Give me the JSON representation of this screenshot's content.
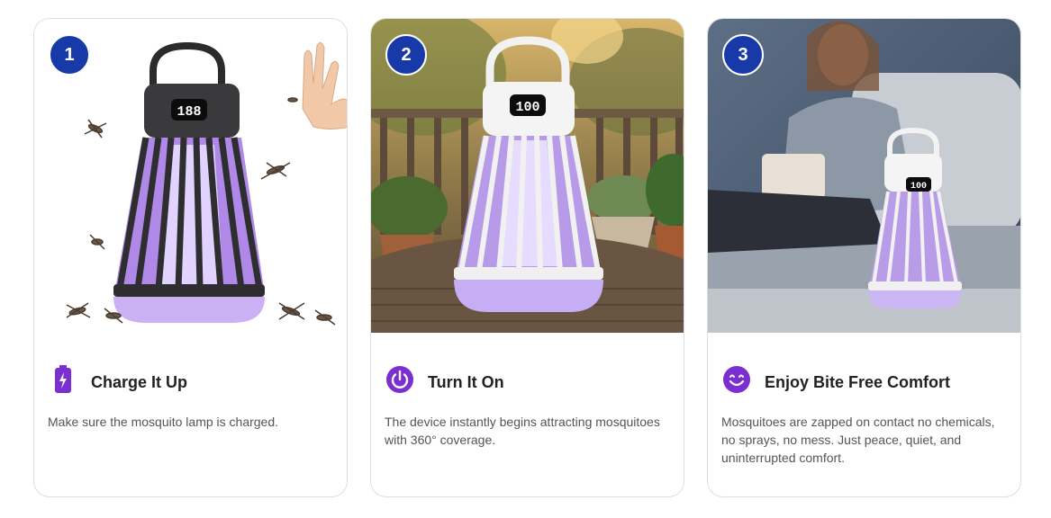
{
  "colors": {
    "badge": "#173aa8",
    "icon_purple": "#7b2fd0",
    "title_text": "#222222",
    "desc_text": "#555555",
    "card_border": "#dedede"
  },
  "cards": [
    {
      "step": "1",
      "icon": "battery-charging-icon",
      "title": "Charge It Up",
      "description": "Make sure the mosquito lamp is charged.",
      "display_reading": "188"
    },
    {
      "step": "2",
      "icon": "power-icon",
      "title": "Turn It On",
      "description": "The device instantly begins attracting mosquitoes with 360° coverage.",
      "display_reading": "100"
    },
    {
      "step": "3",
      "icon": "smile-icon",
      "title": "Enjoy Bite Free Comfort",
      "description": "Mosquitoes are zapped on contact no chemicals, no sprays, no mess. Just peace, quiet, and uninterrupted comfort.",
      "display_reading": "100"
    }
  ]
}
